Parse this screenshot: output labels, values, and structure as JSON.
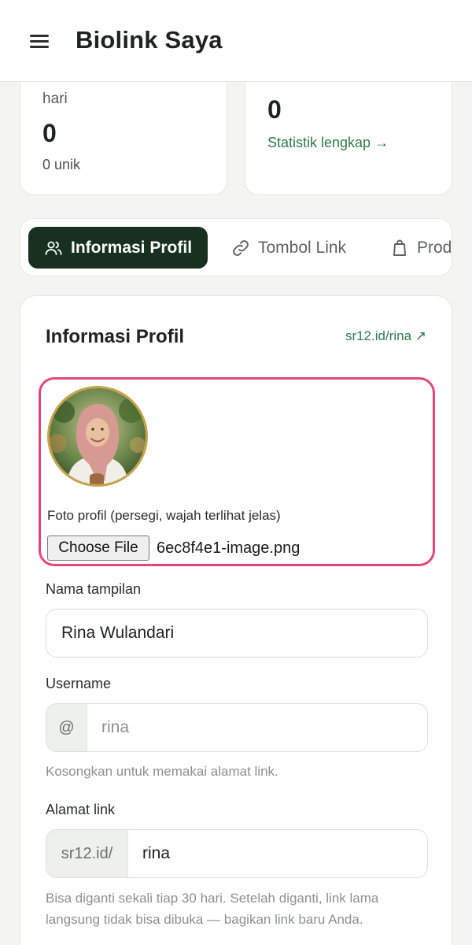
{
  "header": {
    "title": "Biolink Saya",
    "menu_icon": "hamburger-menu-icon"
  },
  "stats": {
    "left": {
      "label": "hari",
      "value": "0",
      "sub": "0 unik"
    },
    "right": {
      "value": "0",
      "link": "Statistik lengkap →"
    }
  },
  "tabs": [
    {
      "label": "Informasi Profil",
      "icon": "users-icon",
      "active": true
    },
    {
      "label": "Tombol Link",
      "icon": "link-icon",
      "active": false
    },
    {
      "label": "Prod",
      "icon": "bag-icon",
      "active": false
    }
  ],
  "profile": {
    "title": "Informasi Profil",
    "url": "sr12.id/rina ↗",
    "photo_caption": "Foto profil (persegi, wajah terlihat jelas)",
    "file_button": "Choose File",
    "file_name": "6ec8f4e1-image.png",
    "display_name_label": "Nama tampilan",
    "display_name_value": "Rina Wulandari",
    "username_label": "Username",
    "username_prefix": "@",
    "username_placeholder": "rina",
    "username_help": "Kosongkan untuk memakai alamat link.",
    "address_label": "Alamat link",
    "address_prefix": "sr12.id/",
    "address_value": "rina",
    "address_help": "Bisa diganti sekali tiap 30 hari. Setelah diganti, link lama langsung tidak bisa dibuka — bagikan link baru Anda."
  },
  "colors": {
    "accent_dark": "#17301f",
    "link_green": "#2f7a4a",
    "highlight_pink": "#e6457a",
    "avatar_ring": "#c7a24a"
  }
}
